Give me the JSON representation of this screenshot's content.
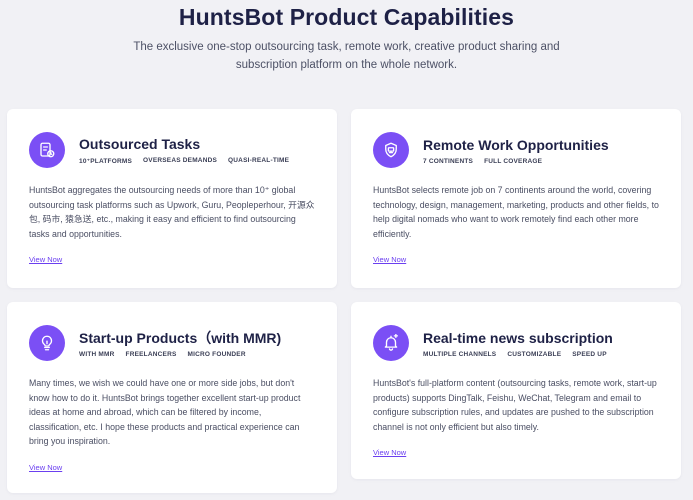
{
  "header": {
    "title": "HuntsBot Product Capabilities",
    "subtitle": "The exclusive one-stop outsourcing task, remote work, creative product sharing and subscription platform on the whole network."
  },
  "accent_color": "#7b4ff5",
  "cards": [
    {
      "title": "Outsourced Tasks",
      "icon": "task-list-icon",
      "tags": [
        "10⁺PLATFORMS",
        "OVERSEAS DEMANDS",
        "QUASI-REAL-TIME"
      ],
      "description": "HuntsBot aggregates the outsourcing needs of more than 10⁺ global outsourcing task platforms such as Upwork, Guru, Peopleperhour, 开源众包, 码市, 猿急送, etc., making it easy and efficient to find outsourcing tasks and opportunities.",
      "link": "View Now"
    },
    {
      "title": "Remote Work Opportunities",
      "icon": "remote-work-icon",
      "tags": [
        "7 CONTINENTS",
        "FULL COVERAGE"
      ],
      "description": "HuntsBot selects remote job on 7 continents around the world, covering technology, design, management, marketing, products and other fields, to help digital nomads who want to work remotely find each other more efficiently.",
      "link": "View Now"
    },
    {
      "title": "Start-up Products（with MMR)",
      "icon": "lightbulb-icon",
      "tags": [
        "WITH MMR",
        "FREELANCERS",
        "MICRO FOUNDER"
      ],
      "description": "Many times, we wish we could have one or more side jobs, but don't know how to do it. HuntsBot brings together excellent start-up product ideas at home and abroad, which can be filtered by income, classification, etc. I hope these products and practical experience can bring you inspiration.",
      "link": "View Now"
    },
    {
      "title": "Real-time news subscription",
      "icon": "bell-icon",
      "tags": [
        "MULTIPLE CHANNELS",
        "CUSTOMIZABLE",
        "SPEED UP"
      ],
      "description": "HuntsBot's full-platform content (outsourcing tasks, remote work, start-up products) supports DingTalk, Feishu, WeChat, Telegram and email to configure subscription rules, and updates are pushed to the subscription channel is not only efficient but also timely.",
      "link": "View Now"
    }
  ]
}
